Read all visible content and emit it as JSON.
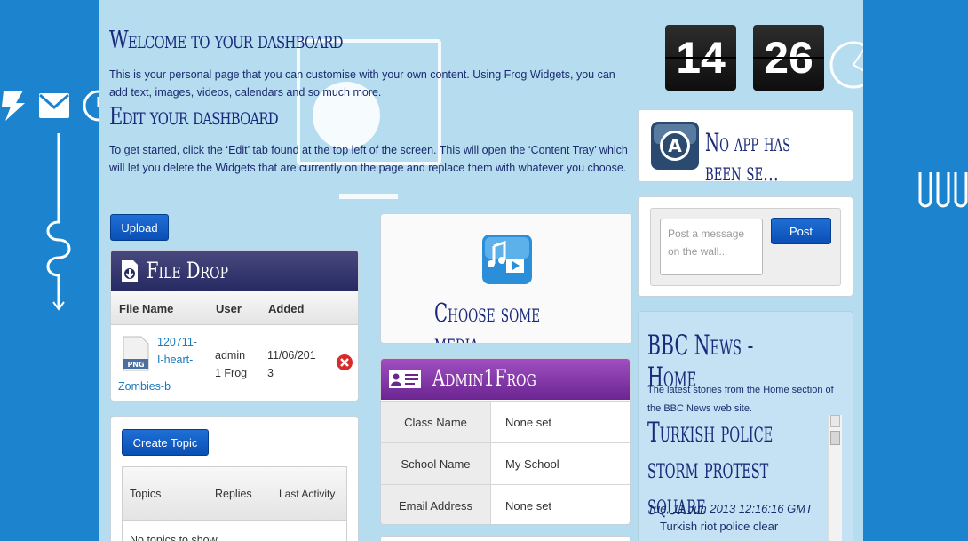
{
  "welcome": {
    "title": "Welcome to your dashboard",
    "text": "This is your personal page that you can customise with your own content. Using Frog Widgets, you can add text, images, videos, calendars and so much more."
  },
  "edit": {
    "title": "Edit your dashboard",
    "text": "To get started, click the ‘Edit’ tab found at the top left of the screen. This will open the ‘Content Tray’ which will let you delete the Widgets that are currently on the page and replace them with whatever you choose."
  },
  "upload": {
    "label": "Upload"
  },
  "file_drop": {
    "title": "File Drop",
    "columns": [
      "File Name",
      "User",
      "Added"
    ],
    "files": [
      {
        "name_lines": [
          "120711-",
          "I-heart-",
          "Zombies-b"
        ],
        "user_lines": [
          "admin",
          "1 Frog"
        ],
        "added_lines": [
          "11/06/201",
          "3"
        ]
      }
    ]
  },
  "forum": {
    "create_label": "Create Topic",
    "columns": [
      "Topics",
      "Replies",
      "Last Activity"
    ],
    "empty_text": "No topics to show"
  },
  "media": {
    "title": "Choose some media"
  },
  "admin": {
    "title": "Admin1Frog",
    "rows": [
      {
        "key": "Class Name",
        "value": "None set"
      },
      {
        "key": "School Name",
        "value": "My School"
      },
      {
        "key": "Email Address",
        "value": "None set"
      }
    ]
  },
  "clock": {
    "hours": "14",
    "minutes": "26"
  },
  "app": {
    "title": "No app has been se..."
  },
  "wall": {
    "placeholder": "Post a message on the wall...",
    "post_label": "Post"
  },
  "news": {
    "title": "BBC News - Home",
    "description": "The latest stories from the Home section of the BBC News web site.",
    "headline": "Turkish police storm protest square",
    "date": "Tue, 11 Jun 2013 12:16:16 GMT",
    "snippet": "Turkish riot police clear"
  }
}
